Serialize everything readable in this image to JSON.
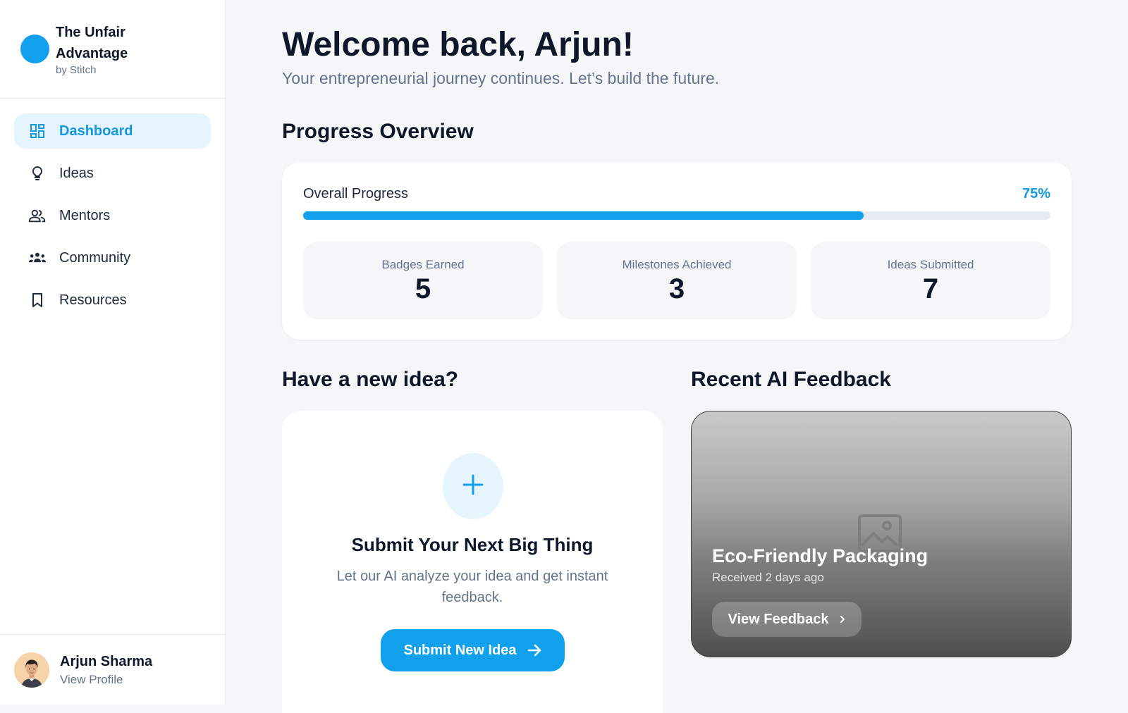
{
  "brand": {
    "title": "The Unfair Advantage",
    "subtitle": "by Stitch",
    "logo_color": "#11a0ec"
  },
  "sidebar": {
    "items": [
      {
        "label": "Dashboard",
        "icon": "dashboard-icon",
        "active": true
      },
      {
        "label": "Ideas",
        "icon": "lightbulb-icon",
        "active": false
      },
      {
        "label": "Mentors",
        "icon": "people-icon",
        "active": false
      },
      {
        "label": "Community",
        "icon": "groups-icon",
        "active": false
      },
      {
        "label": "Resources",
        "icon": "bookmark-icon",
        "active": false
      }
    ]
  },
  "profile": {
    "name": "Arjun Sharma",
    "link": "View Profile"
  },
  "header": {
    "welcome": "Welcome back, Arjun!",
    "subtitle": "Your entrepreneurial journey continues. Let’s build the future."
  },
  "progress": {
    "section_title": "Progress Overview",
    "label": "Overall Progress",
    "percent_text": "75%",
    "percent": 75,
    "stats": [
      {
        "label": "Badges Earned",
        "value": "5"
      },
      {
        "label": "Milestones Achieved",
        "value": "3"
      },
      {
        "label": "Ideas Submitted",
        "value": "7"
      }
    ]
  },
  "idea": {
    "section_title": "Have a new idea?",
    "title": "Submit Your Next Big Thing",
    "description": "Let our AI analyze your idea and get instant feedback.",
    "button": "Submit New Idea"
  },
  "feedback": {
    "section_title": "Recent AI Feedback",
    "title": "Eco-Friendly Packaging",
    "time": "Received 2 days ago",
    "button": "View Feedback"
  },
  "colors": {
    "accent": "#11a0ec",
    "accent_text": "#1398e2",
    "active_bg": "#e6f4fd"
  }
}
